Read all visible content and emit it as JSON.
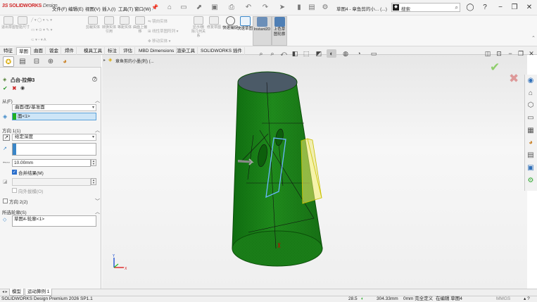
{
  "app": {
    "logo_ds": "3S",
    "logo_sw": "SOLIDWORKS",
    "logo_design": "Design"
  },
  "menu": [
    "文件(F)",
    "编辑(E)",
    "视图(V)",
    "插入(I)",
    "工具(T)",
    "窗口(W)"
  ],
  "window": {
    "doc_title": "草图4 - 章鱼剪的小... (...)",
    "search_placeholder": "搜索"
  },
  "ribbon": {
    "disabled_groups": [
      "退出草图",
      "智能尺寸",
      "",
      "",
      "",
      "",
      "剪裁实体",
      "转换实体引用",
      "等距实体",
      "",
      "",
      "镜向实体",
      "线性草图阵列",
      "移动实体"
    ],
    "tools": [
      {
        "label": "显示/删除几何关系",
        "state": "disabled"
      },
      {
        "label": "修复草图",
        "state": "disabled"
      },
      {
        "label": "快速捕捉",
        "state": "normal"
      },
      {
        "label": "快速草图",
        "state": "normal"
      },
      {
        "label": "Instant2D",
        "state": "active"
      },
      {
        "label": "上色草图轮廓",
        "state": "active"
      }
    ],
    "mirror_label": "镜向实体",
    "linear_array_label": "线性草图阵列",
    "move_label": "移动实体"
  },
  "command_tabs": [
    "特征",
    "草图",
    "曲面",
    "钣金",
    "焊件",
    "模具工具",
    "标注",
    "评估",
    "MBD Dimensions",
    "渲染工具",
    "SOLIDWORKS 插件"
  ],
  "active_command_tab": "草图",
  "viewport": {
    "breadcrumb": "章鱼剪的小墨(刺) (..."
  },
  "property_manager": {
    "title": "凸台-拉伸3",
    "help_icon": "?",
    "from_label": "从(F)",
    "from_value": "曲面/面/基准面",
    "from_selection": "面<1>",
    "direction1_label": "方向 1(1)",
    "end_condition": "给定深度",
    "depth_value": "10.00mm",
    "merge_result_label": "合并结果(M)",
    "draft_outward_label": "向外拔模(O)",
    "direction2_label": "方向 2(2)",
    "contours_label": "所选轮廓(S)",
    "contour_item": "草图4-轮廓<1>"
  },
  "bottom_tabs": [
    "模型",
    "运动算例 1"
  ],
  "status": {
    "product": "SOLIDWORKS Design Premium 2026 SP1.1",
    "coord1": "28.5",
    "coord2": "304.33mm",
    "coord3": "0mm 完全定义",
    "editing": "在编辑 草图4",
    "units": "MMGS"
  },
  "colors": {
    "part_green": "#1f8a1c",
    "ok_green": "#8fce6c",
    "cancel_red": "#d9534f",
    "selection_blue": "#cde5f7"
  }
}
